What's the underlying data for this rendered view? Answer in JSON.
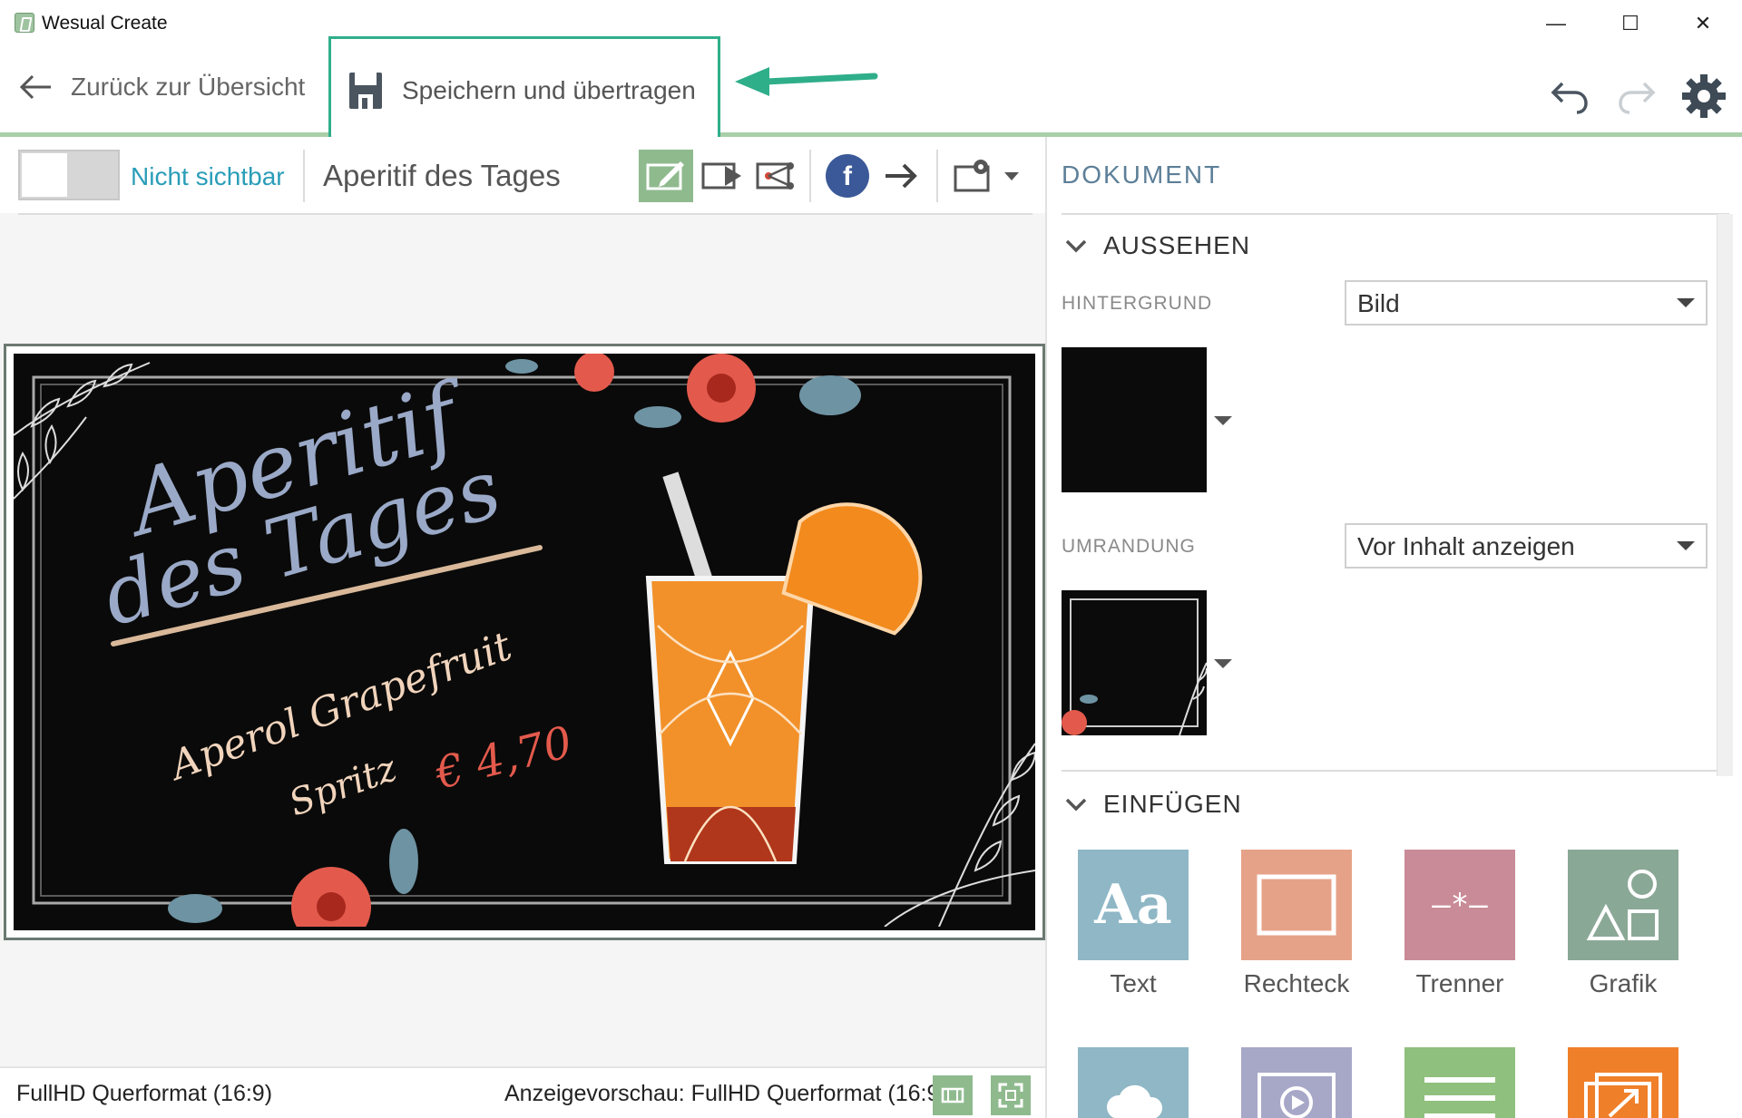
{
  "window": {
    "title": "Wesual Create",
    "minimize_glyph": "—",
    "maximize_glyph": "☐",
    "close_glyph": "✕"
  },
  "toolbar": {
    "back_label": "Zurück zur Übersicht",
    "save_label": "Speichern und übertragen",
    "undo_icon": "undo-icon",
    "redo_icon": "redo-icon",
    "settings_icon": "gear-icon"
  },
  "editor": {
    "visibility_label": "Nicht sichtbar",
    "document_name": "Aperitif des Tages",
    "tools": [
      "edit-icon",
      "play-preview-icon",
      "share-network-icon",
      "facebook-icon",
      "arrow-right-icon",
      "display-settings-icon"
    ],
    "facebook_glyph": "f"
  },
  "canvas": {
    "headline_line1": "Aperitif",
    "headline_line2": "des Tages",
    "drink_line1": "Aperol Grapefruit",
    "drink_line2": "Spritz",
    "price": "€ 4,70"
  },
  "status": {
    "format": "FullHD Querformat (16:9)",
    "preview": "Anzeigevorschau: FullHD Querformat (16:9)"
  },
  "panel": {
    "title": "DOKUMENT",
    "appearance": {
      "header": "AUSSEHEN",
      "background_label": "HINTERGRUND",
      "background_value": "Bild",
      "border_label": "UMRANDUNG",
      "border_value": "Vor Inhalt anzeigen"
    },
    "insert": {
      "header": "EINFÜGEN",
      "tiles": [
        {
          "label": "Text",
          "color": "#8fb7c6",
          "icon": "text-aa-icon",
          "glyph": "Aa"
        },
        {
          "label": "Rechteck",
          "color": "#e6a288",
          "icon": "rectangle-icon"
        },
        {
          "label": "Trenner",
          "color": "#c98b97",
          "icon": "divider-icon",
          "glyph": "—*—"
        },
        {
          "label": "Grafik",
          "color": "#8aa896",
          "icon": "shapes-icon"
        },
        {
          "label": "",
          "color": "#8fb7c6",
          "icon": "cloud-icon"
        },
        {
          "label": "",
          "color": "#a7a7c8",
          "icon": "video-icon"
        },
        {
          "label": "",
          "color": "#8fc07d",
          "icon": "list-icon"
        },
        {
          "label": "",
          "color": "#f07f2a",
          "icon": "external-image-icon"
        }
      ]
    }
  },
  "colors": {
    "accent_green": "#8fba8e",
    "annotation_teal": "#2fae8a",
    "link_blue": "#2a9db8",
    "header_blue": "#5d7f98",
    "facebook_blue": "#3b5998"
  }
}
